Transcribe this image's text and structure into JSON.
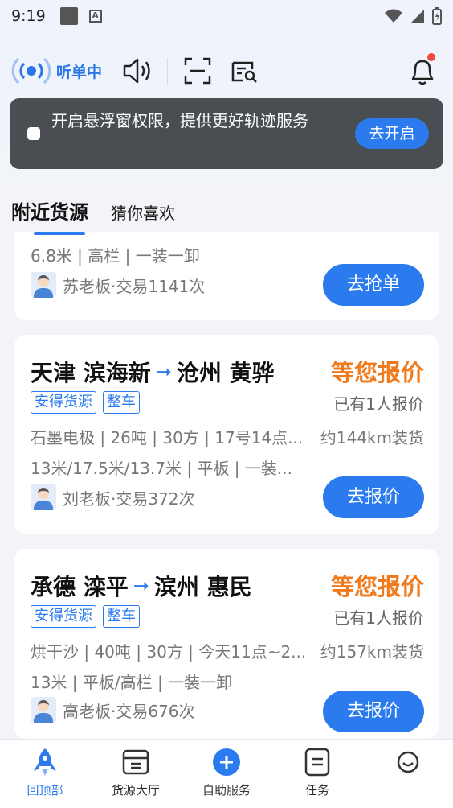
{
  "status_bar": {
    "time": "9:19",
    "a_glyph": "A"
  },
  "toolbar": {
    "listen_label": "听单中",
    "icons": [
      "radio-broadcast-icon",
      "speaker-icon",
      "scan-icon",
      "search-vehicle-icon",
      "bell-icon"
    ]
  },
  "banner": {
    "text": "开启悬浮窗权限，提供更好轨迹服务",
    "button": "去开启"
  },
  "section": {
    "title": "附近货源",
    "subtitle": "猜你喜欢"
  },
  "cards": [
    {
      "detail2": "6.8米 | 高栏 | 一装一卸",
      "owner": "苏老板·交易1141次",
      "button": "去抢单"
    },
    {
      "origin": "天津 滨海新",
      "arrow": "➞",
      "destination": "沧州 黄骅",
      "price": "等您报价",
      "tags": [
        "安得货源",
        "整车"
      ],
      "quote_count": "已有1人报价",
      "detail1": "石墨电极 | 26吨 | 30方 | 17号14点...",
      "distance": "约144km装货",
      "detail2": "13米/17.5米/13.7米 | 平板 | 一装...",
      "owner": "刘老板·交易372次",
      "button": "去报价"
    },
    {
      "origin": "承德 滦平",
      "arrow": "➞",
      "destination": "滨州 惠民",
      "price": "等您报价",
      "tags": [
        "安得货源",
        "整车"
      ],
      "quote_count": "已有1人报价",
      "detail1": "烘干沙 | 40吨 | 30方 | 今天11点~2...",
      "distance": "约157km装货",
      "detail2": "13米 | 平板/高栏 | 一装一卸",
      "owner": "高老板·交易676次",
      "button": "去报价"
    }
  ],
  "bottom_nav": [
    {
      "label": "回顶部",
      "icon": "rocket-icon",
      "active": true
    },
    {
      "label": "货源大厅",
      "icon": "cargo-hall-icon",
      "active": false
    },
    {
      "label": "自助服务",
      "icon": "plus-circle-icon",
      "active": false
    },
    {
      "label": "任务",
      "icon": "task-icon",
      "active": false
    },
    {
      "label": "",
      "icon": "smiley-icon",
      "active": false
    }
  ],
  "colors": {
    "accent": "#2b7bee",
    "price": "#f07a1c",
    "banner_bg": "#4a4d52"
  }
}
